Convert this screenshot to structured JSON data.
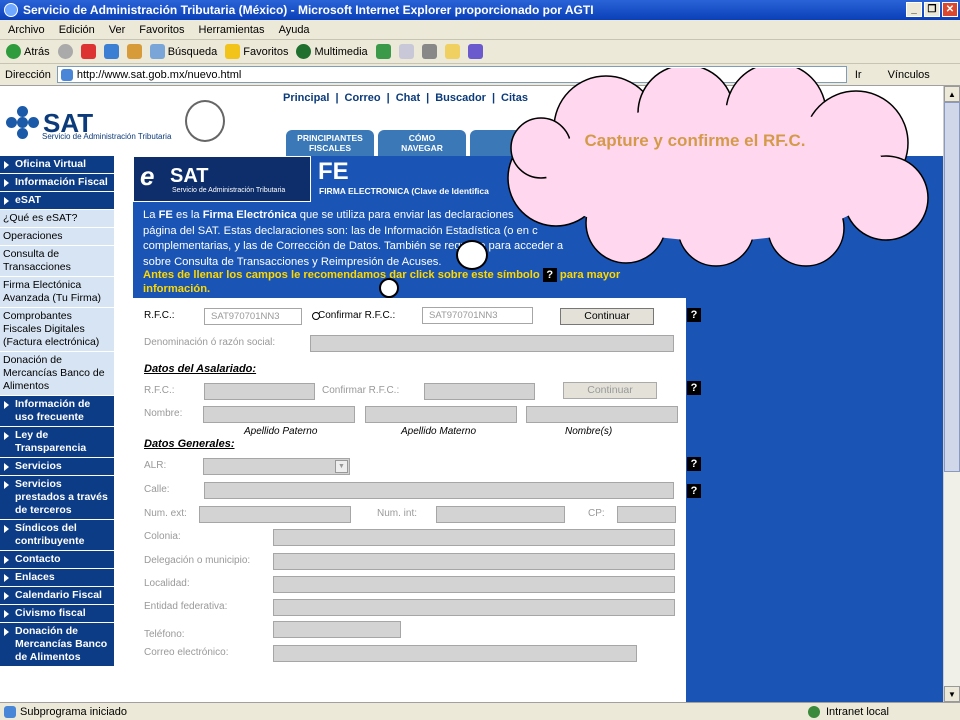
{
  "window": {
    "title": "Servicio de Administración Tributaria (México) - Microsoft Internet Explorer proporcionado por AGTI",
    "buttons": [
      "_",
      "❐",
      "✕"
    ]
  },
  "menu": [
    "Archivo",
    "Edición",
    "Ver",
    "Favoritos",
    "Herramientas",
    "Ayuda"
  ],
  "toolbar": {
    "back": "Atrás",
    "search": "Búsqueda",
    "favorites": "Favoritos",
    "media": "Multimedia"
  },
  "address": {
    "label": "Dirección",
    "url": "http://www.sat.gob.mx/nuevo.html",
    "go": "Ir",
    "links": "Vínculos"
  },
  "status": {
    "left": "Subprograma iniciado",
    "zone": "Intranet local"
  },
  "sat": {
    "logo": "SAT",
    "subtitle": "Servicio de Administración Tributaria",
    "topnav": [
      "Principal",
      "|",
      "Correo",
      "|",
      "Chat",
      "|",
      "Buscador",
      "|",
      "Citas"
    ],
    "tabs": [
      [
        "PRINCIPIANTES",
        "FISCALES"
      ],
      [
        "CÓMO",
        "NAVEGAR"
      ]
    ]
  },
  "sidebar": [
    {
      "label": "Oficina Virtual",
      "style": "dark"
    },
    {
      "label": "Información Fiscal",
      "style": "dark"
    },
    {
      "label": "eSAT",
      "style": "dark"
    },
    {
      "label": "¿Qué es eSAT?",
      "style": "light"
    },
    {
      "label": "Operaciones",
      "style": "light"
    },
    {
      "label": "Consulta de Transacciones",
      "style": "light"
    },
    {
      "label": "Firma Electónica Avanzada (Tu Firma)",
      "style": "light"
    },
    {
      "label": "Comprobantes Fiscales Digitales (Factura electrónica)",
      "style": "light"
    },
    {
      "label": "Donación de Mercancías Banco de Alimentos",
      "style": "light"
    },
    {
      "label": "Información de uso frecuente",
      "style": "dark"
    },
    {
      "label": "Ley de Transparencia",
      "style": "dark"
    },
    {
      "label": "Servicios",
      "style": "dark"
    },
    {
      "label": "Servicios prestados a través de terceros",
      "style": "dark"
    },
    {
      "label": "Síndicos del contribuyente",
      "style": "dark"
    },
    {
      "label": "Contacto",
      "style": "dark"
    },
    {
      "label": "Enlaces",
      "style": "dark"
    },
    {
      "label": "Calendario Fiscal",
      "style": "dark"
    },
    {
      "label": "Civismo fiscal",
      "style": "dark"
    },
    {
      "label": "Donación de Mercancías Banco de Alimentos",
      "style": "dark"
    }
  ],
  "fe_header": {
    "esat_e": "e",
    "esat_sat": "SAT",
    "esat_sub": "Servicio de Administración Tributaria",
    "title": "FE",
    "subtitle": "FIRMA ELECTRONICA (Clave de Identifica"
  },
  "intro": {
    "p1": "La",
    "fe": "FE",
    "p2": "es la",
    "firma": "Firma Electrónica",
    "p3": "que se utiliza para enviar las declaraciones",
    "line2": "página del SAT. Estas declaraciones son: las de Información Estadística (o en c",
    "line3": "complementarias, y las de Corrección de Datos. También se requiere para acceder a",
    "line4": "sobre Consulta de Transacciones y Reimpresión de Acuses."
  },
  "warning": {
    "a": "Antes de llenar los campos le recomendamos dar click sobre este símbolo",
    "b": "para mayor",
    "c": "información.",
    "q": "?"
  },
  "form": {
    "rfc_label": "R.F.C.:",
    "rfc_value": "SAT970701NN3",
    "confirm_label": "Confirmar R.F.C.:",
    "confirm_value": "SAT970701NN3",
    "continuar": "Continuar",
    "denominacion": "Denominación ó razón social:",
    "asalariado_title": "Datos del Asalariado:",
    "rfc2": "R.F.C.:",
    "confirm2": "Confirmar R.F.C.:",
    "continuar2": "Continuar",
    "nombre": "Nombre:",
    "apellido_p": "Apellido Paterno",
    "apellido_m": "Apellido Materno",
    "nombres": "Nombre(s)",
    "generales_title": "Datos Generales:",
    "alr": "ALR:",
    "calle": "Calle:",
    "num_ext": "Num. ext:",
    "num_int": "Num. int:",
    "cp": "CP:",
    "colonia": "Colonia:",
    "delegacion": "Delegación o municipio:",
    "localidad": "Localidad:",
    "entidad": "Entidad federativa:",
    "telefono": "Teléfono:",
    "correo": "Correo electrónico:",
    "q": "?"
  },
  "callout": {
    "text": "Capture y confirme el RF.C."
  }
}
